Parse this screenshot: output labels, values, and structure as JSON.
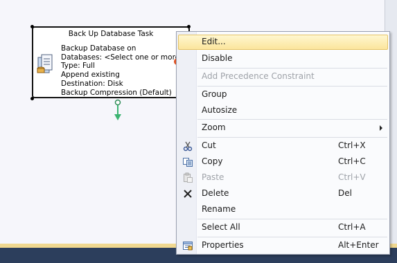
{
  "task": {
    "title": "Back Up Database Task",
    "lines": [
      "Backup Database on",
      "Databases: <Select one or more>",
      "Type: Full",
      "Append existing",
      "Destination: Disk",
      "Backup Compression (Default)"
    ],
    "icon": "backup-task-icon"
  },
  "menu": {
    "items": [
      {
        "label": "Edit...",
        "shortcut": "",
        "icon": "",
        "state": "highlighted"
      },
      {
        "label": "Disable",
        "shortcut": "",
        "icon": "",
        "state": "normal"
      },
      {
        "label": "Add Precedence Constraint",
        "shortcut": "",
        "icon": "",
        "state": "disabled"
      },
      {
        "label": "Group",
        "shortcut": "",
        "icon": "",
        "state": "normal"
      },
      {
        "label": "Autosize",
        "shortcut": "",
        "icon": "",
        "state": "normal"
      },
      {
        "label": "Zoom",
        "shortcut": "",
        "icon": "submenu-arrow",
        "state": "normal"
      },
      {
        "label": "Cut",
        "shortcut": "Ctrl+X",
        "icon": "scissors-icon",
        "state": "normal"
      },
      {
        "label": "Copy",
        "shortcut": "Ctrl+C",
        "icon": "copy-icon",
        "state": "normal"
      },
      {
        "label": "Paste",
        "shortcut": "Ctrl+V",
        "icon": "paste-icon",
        "state": "disabled"
      },
      {
        "label": "Delete",
        "shortcut": "Del",
        "icon": "delete-x-icon",
        "state": "normal"
      },
      {
        "label": "Rename",
        "shortcut": "",
        "icon": "",
        "state": "normal"
      },
      {
        "label": "Select All",
        "shortcut": "Ctrl+A",
        "icon": "",
        "state": "normal"
      },
      {
        "label": "Properties",
        "shortcut": "Alt+Enter",
        "icon": "properties-icon",
        "state": "normal"
      }
    ]
  },
  "colors": {
    "highlight": "#fbe59c",
    "connector": "#3cb371",
    "disabled_text": "#9ea2a8"
  }
}
